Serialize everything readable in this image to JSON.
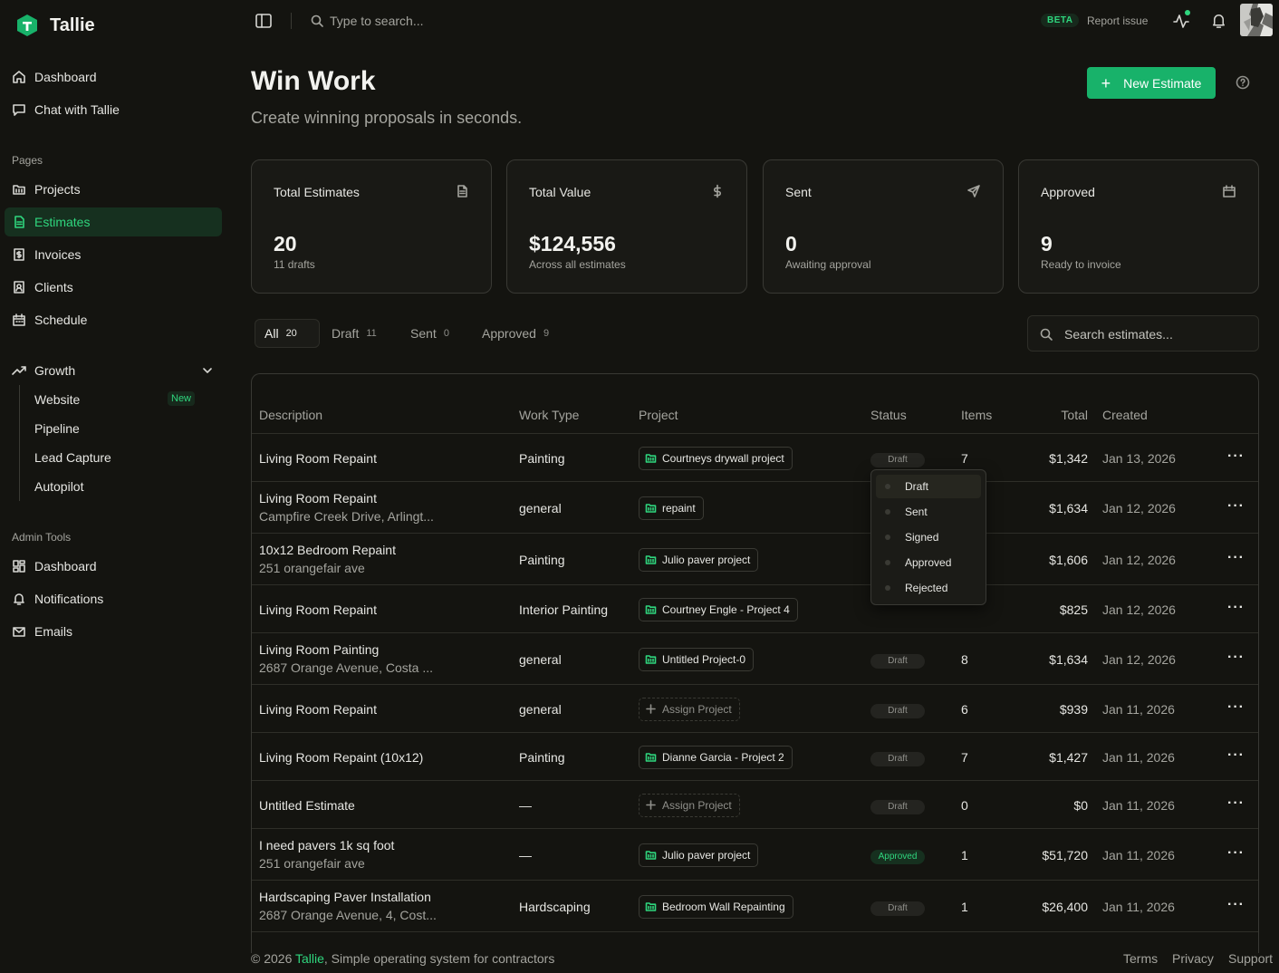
{
  "brand": {
    "name": "Tallie",
    "accent": "#2fd67e"
  },
  "sidebar": {
    "top": [
      {
        "label": "Dashboard",
        "icon": "home-icon"
      },
      {
        "label": "Chat with Tallie",
        "icon": "chat-icon"
      }
    ],
    "pages_label": "Pages",
    "pages": [
      {
        "label": "Projects",
        "icon": "folder-icon"
      },
      {
        "label": "Estimates",
        "icon": "file-text-icon",
        "active": true
      },
      {
        "label": "Invoices",
        "icon": "dollar-receipt-icon"
      },
      {
        "label": "Clients",
        "icon": "contact-icon"
      },
      {
        "label": "Schedule",
        "icon": "calendar-icon"
      }
    ],
    "growth": {
      "label": "Growth",
      "items": [
        {
          "label": "Website",
          "badge": "New"
        },
        {
          "label": "Pipeline"
        },
        {
          "label": "Lead Capture"
        },
        {
          "label": "Autopilot"
        }
      ]
    },
    "admin_label": "Admin Tools",
    "admin": [
      {
        "label": "Dashboard",
        "icon": "dashboard-grid-icon"
      },
      {
        "label": "Notifications",
        "icon": "bell-icon"
      },
      {
        "label": "Emails",
        "icon": "mail-icon"
      }
    ]
  },
  "topbar": {
    "search_placeholder": "Type to search...",
    "beta": "BETA",
    "report": "Report issue"
  },
  "header": {
    "title": "Win Work",
    "subtitle": "Create winning proposals in seconds.",
    "new_button": "New Estimate"
  },
  "stats": [
    {
      "title": "Total Estimates",
      "value": "20",
      "caption": "11 drafts",
      "icon": "file-icon"
    },
    {
      "title": "Total Value",
      "value": "$124,556",
      "caption": "Across all estimates",
      "icon": "dollar-icon"
    },
    {
      "title": "Sent",
      "value": "0",
      "caption": "Awaiting approval",
      "icon": "send-icon"
    },
    {
      "title": "Approved",
      "value": "9",
      "caption": "Ready to invoice",
      "icon": "calendar-icon"
    }
  ],
  "tabs": [
    {
      "label": "All",
      "count": "20",
      "active": true
    },
    {
      "label": "Draft",
      "count": "11"
    },
    {
      "label": "Sent",
      "count": "0"
    },
    {
      "label": "Approved",
      "count": "9"
    }
  ],
  "search_placeholder": "Search estimates...",
  "table": {
    "headers": [
      "Description",
      "Work Type",
      "Project",
      "Status",
      "Items",
      "Total",
      "Created"
    ],
    "rows": [
      {
        "desc": "Living Room Repaint",
        "sub": "",
        "work": "Painting",
        "project": "Courtneys drywall project",
        "assign": false,
        "status": "Draft",
        "items": "7",
        "total": "$1,342",
        "created": "Jan 13, 2026"
      },
      {
        "desc": "Living Room Repaint",
        "sub": "Campfire Creek Drive, Arlingt...",
        "work": "general",
        "project": "repaint",
        "assign": false,
        "status": "",
        "items": "",
        "total": "$1,634",
        "created": "Jan 12, 2026"
      },
      {
        "desc": "10x12 Bedroom Repaint",
        "sub": "251 orangefair ave",
        "work": "Painting",
        "project": "Julio paver project",
        "assign": false,
        "status": "",
        "items": "",
        "total": "$1,606",
        "created": "Jan 12, 2026"
      },
      {
        "desc": "Living Room Repaint",
        "sub": "",
        "work": "Interior Painting",
        "project": "Courtney Engle - Project 4",
        "assign": false,
        "status": "",
        "items": "",
        "total": "$825",
        "created": "Jan 12, 2026"
      },
      {
        "desc": "Living Room Painting",
        "sub": "2687 Orange Avenue, Costa ...",
        "work": "general",
        "project": "Untitled Project-0",
        "assign": false,
        "status": "Draft",
        "items": "8",
        "total": "$1,634",
        "created": "Jan 12, 2026"
      },
      {
        "desc": "Living Room Repaint",
        "sub": "",
        "work": "general",
        "project": "Assign Project",
        "assign": true,
        "status": "Draft",
        "items": "6",
        "total": "$939",
        "created": "Jan 11, 2026"
      },
      {
        "desc": "Living Room Repaint (10x12)",
        "sub": "",
        "work": "Painting",
        "project": "Dianne Garcia - Project 2",
        "assign": false,
        "status": "Draft",
        "items": "7",
        "total": "$1,427",
        "created": "Jan 11, 2026"
      },
      {
        "desc": "Untitled Estimate",
        "sub": "",
        "work": "—",
        "project": "Assign Project",
        "assign": true,
        "status": "Draft",
        "items": "0",
        "total": "$0",
        "created": "Jan 11, 2026"
      },
      {
        "desc": "I need pavers 1k sq foot",
        "sub": "251 orangefair ave",
        "work": "—",
        "project": "Julio paver project",
        "assign": false,
        "status": "Approved",
        "items": "1",
        "total": "$51,720",
        "created": "Jan 11, 2026"
      },
      {
        "desc": "Hardscaping Paver Installation",
        "sub": "2687 Orange Avenue, 4, Cost...",
        "work": "Hardscaping",
        "project": "Bedroom Wall Repainting",
        "assign": false,
        "status": "Draft",
        "items": "1",
        "total": "$26,400",
        "created": "Jan 11, 2026"
      }
    ]
  },
  "status_menu": [
    "Draft",
    "Sent",
    "Signed",
    "Approved",
    "Rejected"
  ],
  "footer": {
    "copyright": "© 2026",
    "brand": "Tallie",
    "tagline": ", Simple operating system for contractors",
    "links": [
      "Terms",
      "Privacy",
      "Support"
    ]
  }
}
